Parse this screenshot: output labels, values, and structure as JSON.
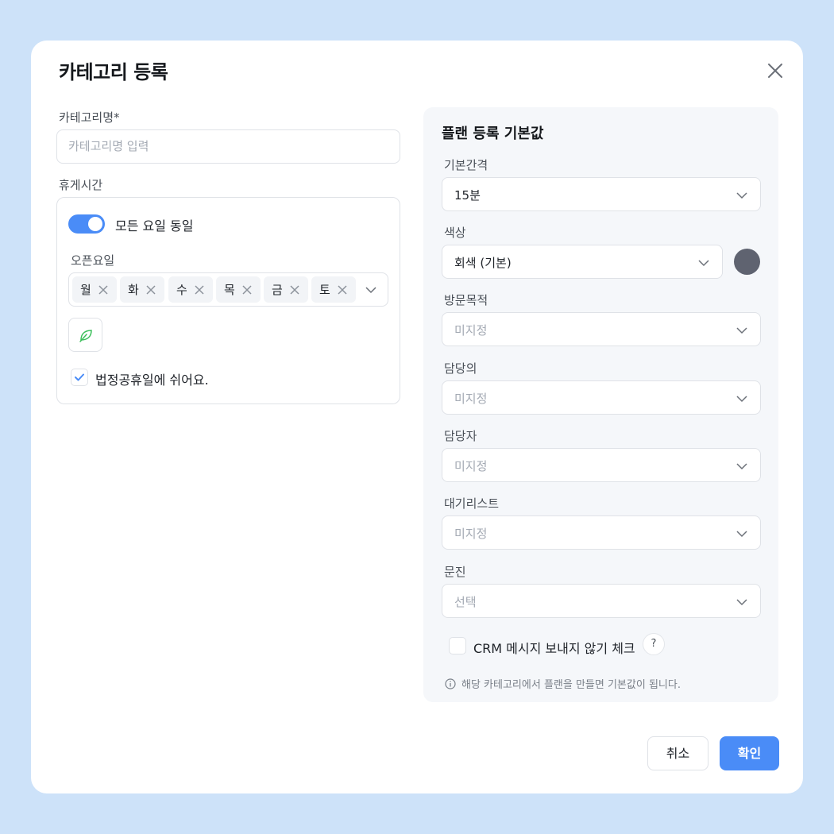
{
  "modal": {
    "title": "카테고리 등록"
  },
  "category_name": {
    "label": "카테고리명*",
    "placeholder": "카테고리명 입력"
  },
  "break_time": {
    "label": "휴게시간",
    "toggle_label": "모든 요일 동일",
    "toggle_on": true,
    "open_days_label": "오픈요일",
    "days": [
      "월",
      "화",
      "수",
      "목",
      "금",
      "토"
    ],
    "holiday_label": "법정공휴일에 쉬어요.",
    "holiday_checked": true
  },
  "plan_defaults": {
    "title": "플랜 등록 기본값",
    "interval": {
      "label": "기본간격",
      "value": "15분"
    },
    "color": {
      "label": "색상",
      "value": "회색 (기본)",
      "swatch": "#5f6370"
    },
    "purpose": {
      "label": "방문목적",
      "value": "미지정"
    },
    "doctor": {
      "label": "담당의",
      "value": "미지정"
    },
    "staff": {
      "label": "담당자",
      "value": "미지정"
    },
    "waitlist": {
      "label": "대기리스트",
      "value": "미지정"
    },
    "questionnaire": {
      "label": "문진",
      "value": "선택"
    },
    "crm_label": "CRM 메시지 보내지 않기 체크",
    "help_icon": "?",
    "info_text": "해당 카테고리에서 플랜을 만들면 기본값이 됩니다."
  },
  "footer": {
    "cancel_label": "취소",
    "confirm_label": "확인"
  },
  "colors": {
    "accent": "#4a8cf7",
    "background": "#cde2f9",
    "leaf_icon": "#3cbf5a"
  }
}
